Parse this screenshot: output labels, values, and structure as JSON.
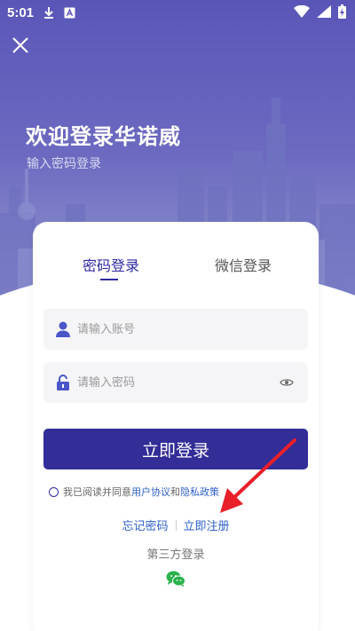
{
  "status_bar": {
    "time": "5:01",
    "icons": [
      "download-icon",
      "a-notification-icon",
      "wifi-icon",
      "signal-icon",
      "battery-charging-icon"
    ]
  },
  "header": {
    "close_icon": "close-icon",
    "title": "欢迎登录华诺威",
    "subtitle": "输入密码登录"
  },
  "tabs": [
    {
      "label": "密码登录",
      "active": true
    },
    {
      "label": "微信登录",
      "active": false
    }
  ],
  "form": {
    "account": {
      "placeholder": "请输入账号",
      "value": "",
      "icon": "user-icon"
    },
    "password": {
      "placeholder": "请输入密码",
      "value": "",
      "icon": "lock-icon",
      "toggle_icon": "eye-icon"
    },
    "login_button": "立即登录"
  },
  "agreement": {
    "prefix": "我已阅读并同意",
    "user_agreement": "用户协议",
    "and": "和",
    "privacy_policy": "隐私政策",
    "checked": false
  },
  "links": {
    "forgot_password": "忘记密码",
    "register": "立即注册"
  },
  "third_party": {
    "label": "第三方登录",
    "icon": "wechat-icon"
  },
  "colors": {
    "primary": "#332d97",
    "link": "#2e5fc8",
    "hero": "#5a56b8",
    "arrow": "#e8202a"
  }
}
